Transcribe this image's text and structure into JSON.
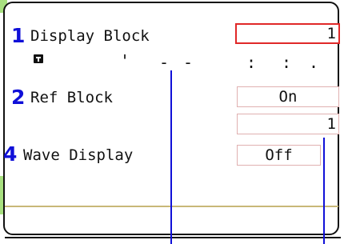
{
  "markers": {
    "display_block": "1",
    "ref_block": "2",
    "wave_display": "4"
  },
  "fields": {
    "display_block": {
      "label": "Display Block",
      "value": "1"
    },
    "ref_block": {
      "label": "Ref Block",
      "toggle": "On",
      "value": "1"
    },
    "wave_display": {
      "label": "Wave Display",
      "value": "Off"
    }
  },
  "timestamp": {
    "date_chars": [
      "'",
      "-",
      "-"
    ],
    "time_chars": [
      ":",
      ":",
      "."
    ]
  },
  "colors": {
    "marker_blue": "#1010d8",
    "selected_border": "#e02828",
    "field_border": "#e0b0b0",
    "divider": "#c8b878",
    "tab_green": "#a8e080"
  },
  "icons": [
    "timestamp-icon"
  ]
}
